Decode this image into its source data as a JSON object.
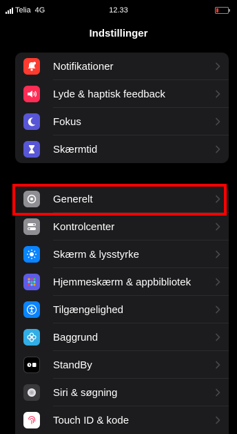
{
  "status_bar": {
    "carrier": "Telia",
    "network": "4G",
    "time": "12.33",
    "battery_color": "#ff3b30"
  },
  "header": {
    "title": "Indstillinger"
  },
  "groups": [
    {
      "items": [
        {
          "label": "Notifikationer",
          "icon": "bell-icon",
          "color": "#ff3b30"
        },
        {
          "label": "Lyde & haptisk feedback",
          "icon": "speaker-icon",
          "color": "#ff2d55"
        },
        {
          "label": "Fokus",
          "icon": "moon-icon",
          "color": "#5856d6"
        },
        {
          "label": "Skærmtid",
          "icon": "hourglass-icon",
          "color": "#5856d6"
        }
      ]
    },
    {
      "items": [
        {
          "label": "Generelt",
          "icon": "gear-icon",
          "color": "#8e8e93",
          "highlighted": true
        },
        {
          "label": "Kontrolcenter",
          "icon": "toggles-icon",
          "color": "#8e8e93"
        },
        {
          "label": "Skærm & lysstyrke",
          "icon": "sun-icon",
          "color": "#0a84ff"
        },
        {
          "label": "Hjemmeskærm & appbibliotek",
          "icon": "grid-icon",
          "color": "#5e5ce6"
        },
        {
          "label": "Tilgængelighed",
          "icon": "accessibility-icon",
          "color": "#0a84ff"
        },
        {
          "label": "Baggrund",
          "icon": "flower-icon",
          "color": "#32ade6"
        },
        {
          "label": "StandBy",
          "icon": "standby-icon",
          "color": "#1c1c1e"
        },
        {
          "label": "Siri & søgning",
          "icon": "siri-icon",
          "color": "#3a3a3c"
        },
        {
          "label": "Touch ID & kode",
          "icon": "fingerprint-icon",
          "color": "#ff3b30"
        }
      ]
    }
  ],
  "annotation": {
    "color": "#ff0000",
    "target": "Generelt"
  }
}
